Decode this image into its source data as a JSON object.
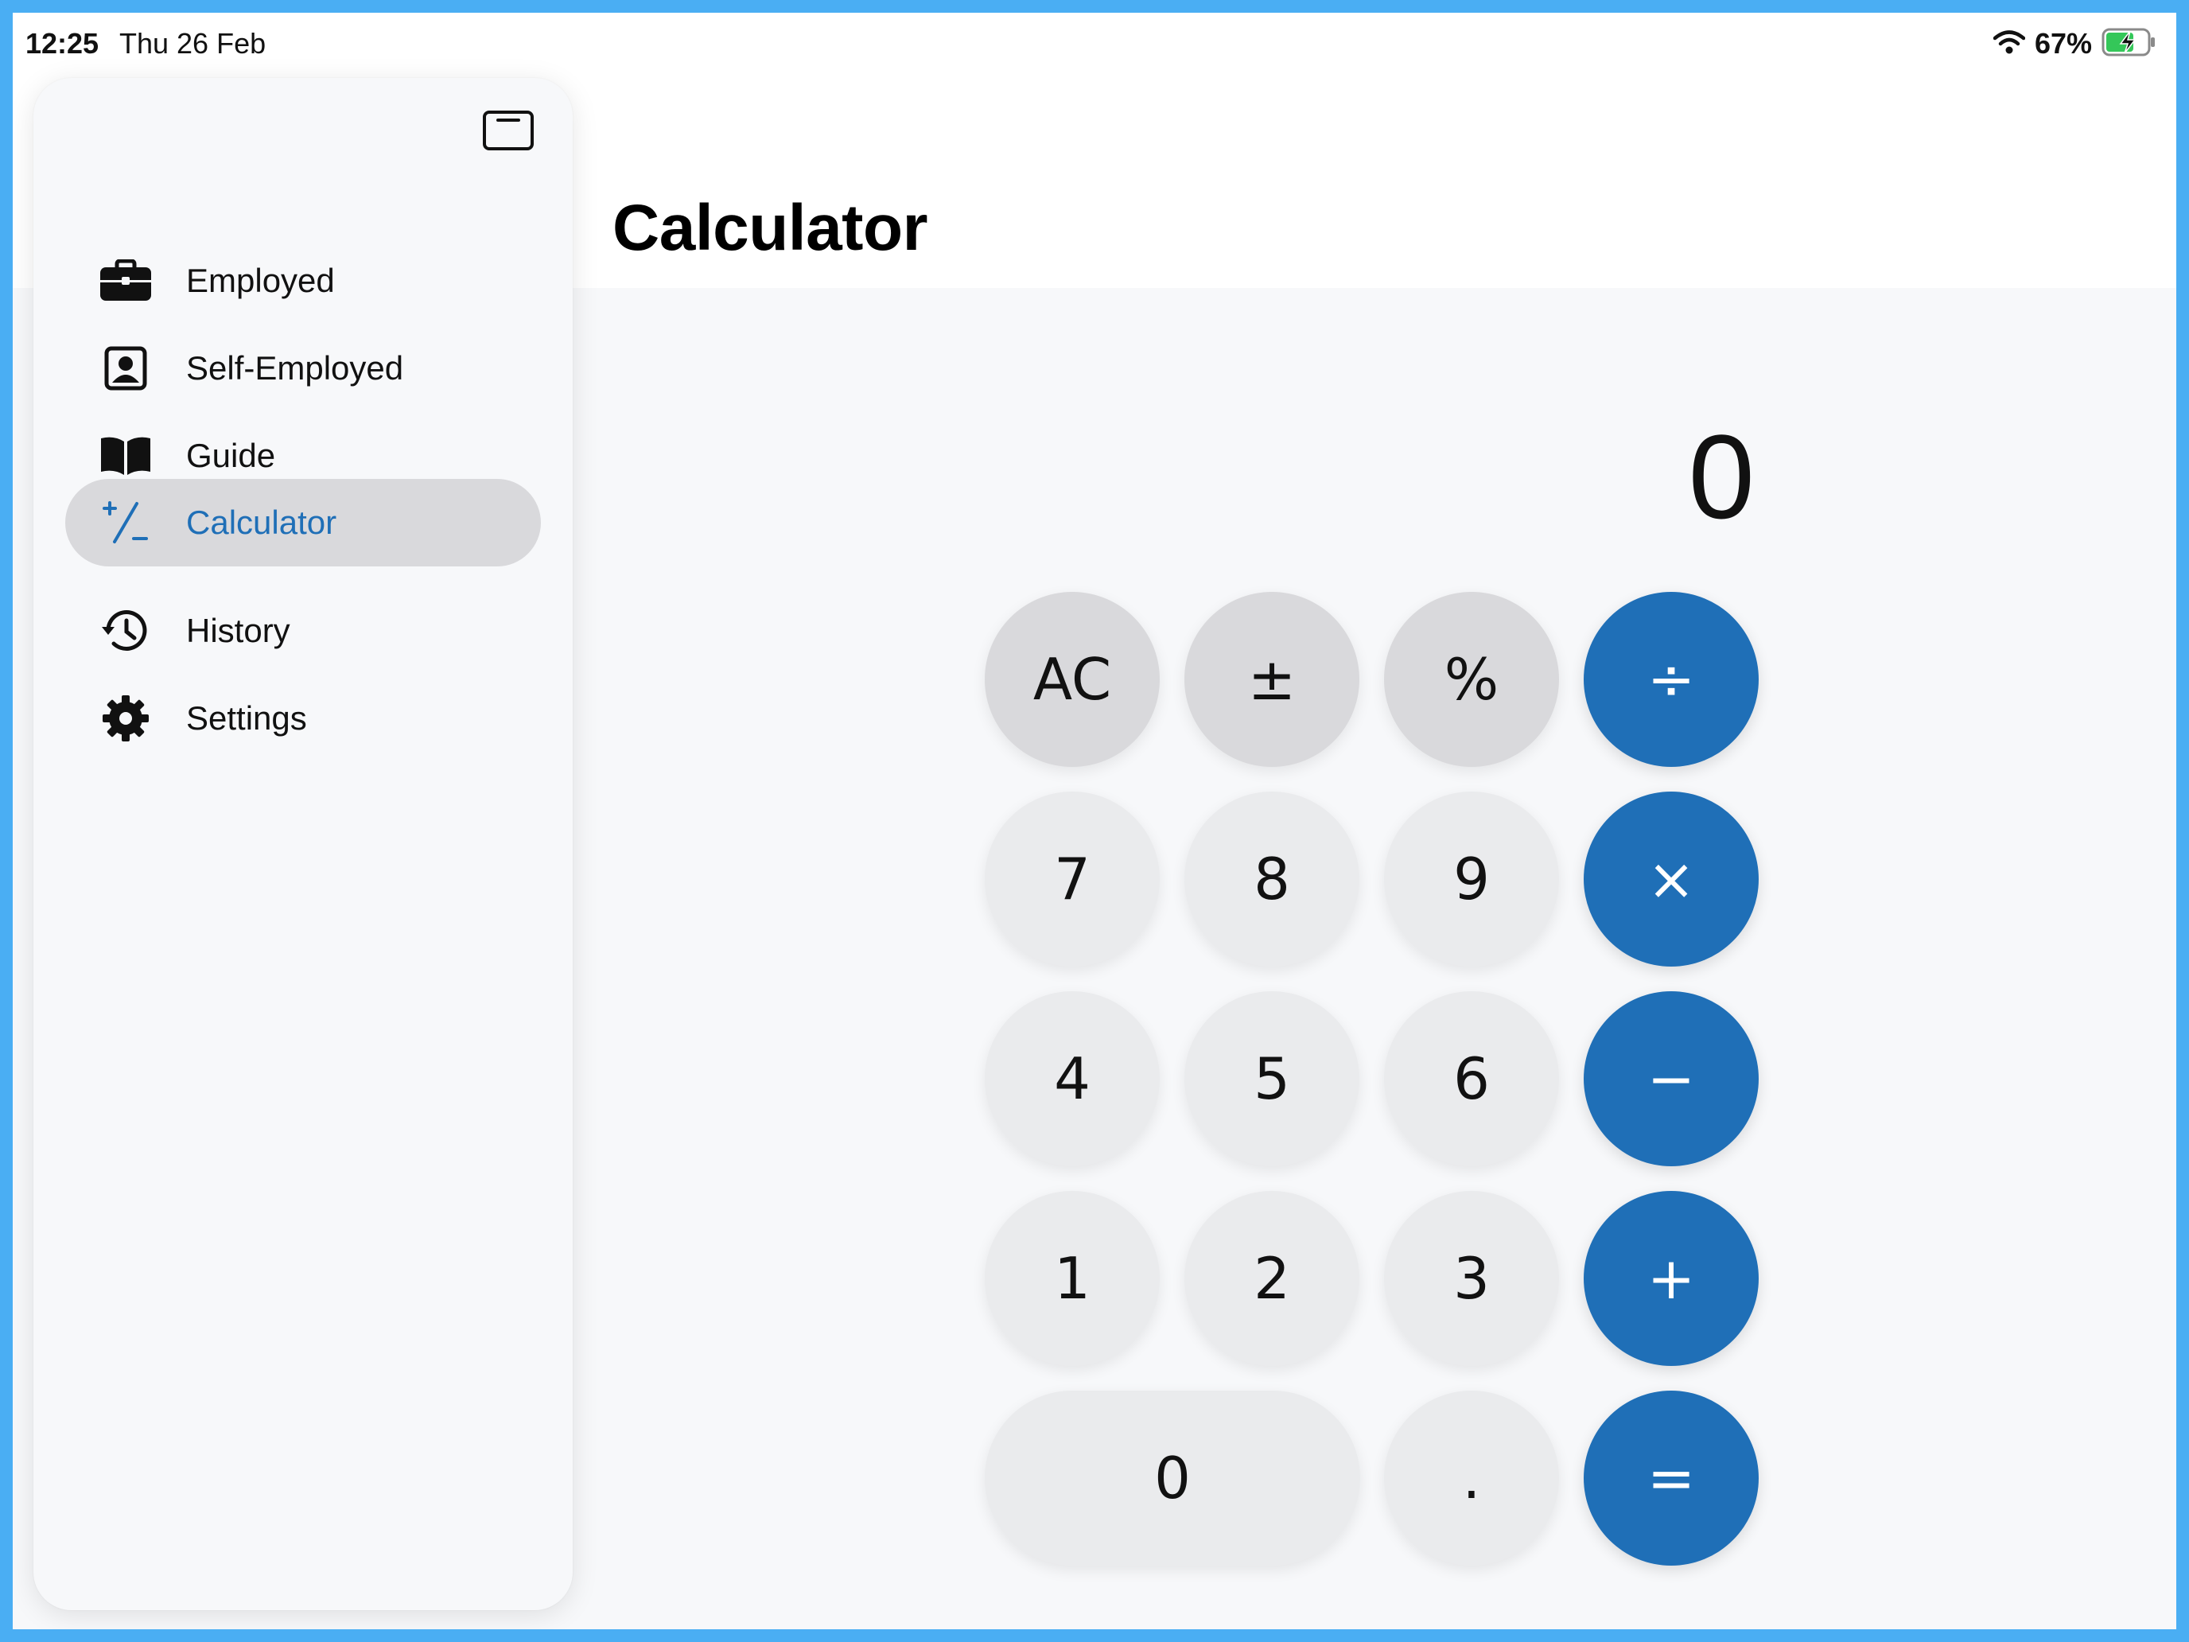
{
  "status_bar": {
    "time": "12:25",
    "date": "Thu 26 Feb",
    "battery": "67%",
    "icons": [
      "wifi-icon",
      "battery-charging-icon"
    ]
  },
  "sidebar": {
    "toggle_icon": "sidebar-toggle-icon",
    "items": [
      {
        "label": "Employed",
        "icon": "briefcase-icon"
      },
      {
        "label": "Self-Employed",
        "icon": "person-badge-icon"
      },
      {
        "label": "Guide",
        "icon": "book-icon"
      },
      {
        "label": "Calculator",
        "icon": "plus-slash-minus-icon"
      },
      {
        "label": "History",
        "icon": "history-clock-icon"
      },
      {
        "label": "Settings",
        "icon": "gear-icon"
      }
    ],
    "active_item": "Calculator"
  },
  "header": {
    "title": "Calculator"
  },
  "calculator": {
    "display": "0",
    "keys": {
      "ac": "AC",
      "plus_minus": "±",
      "percent": "%",
      "divide": "÷",
      "seven": "7",
      "eight": "8",
      "nine": "9",
      "multiply": "×",
      "four": "4",
      "five": "5",
      "six": "6",
      "minus": "−",
      "one": "1",
      "two": "2",
      "three": "3",
      "plus": "+",
      "zero": "0",
      "decimal": ".",
      "equals": "="
    }
  },
  "colors": {
    "accent": "#1f6fb7",
    "function_key": "#d9d9dc",
    "number_key": "#eaebed",
    "active_nav": "#d9d9dc"
  }
}
